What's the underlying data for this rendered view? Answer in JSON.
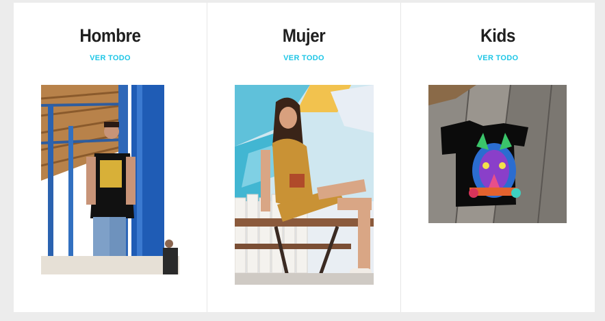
{
  "categories": [
    {
      "title": "Hombre",
      "link": "VER TODO",
      "image": "man-in-tshirt-photo"
    },
    {
      "title": "Mujer",
      "link": "VER TODO",
      "image": "woman-in-dress-photo"
    },
    {
      "title": "Kids",
      "link": "VER TODO",
      "image": "kids-tshirt-on-wood-photo"
    }
  ],
  "colors": {
    "background": "#ececec",
    "panel": "#ffffff",
    "title": "#1f1f1f",
    "link": "#1ec6e6"
  }
}
